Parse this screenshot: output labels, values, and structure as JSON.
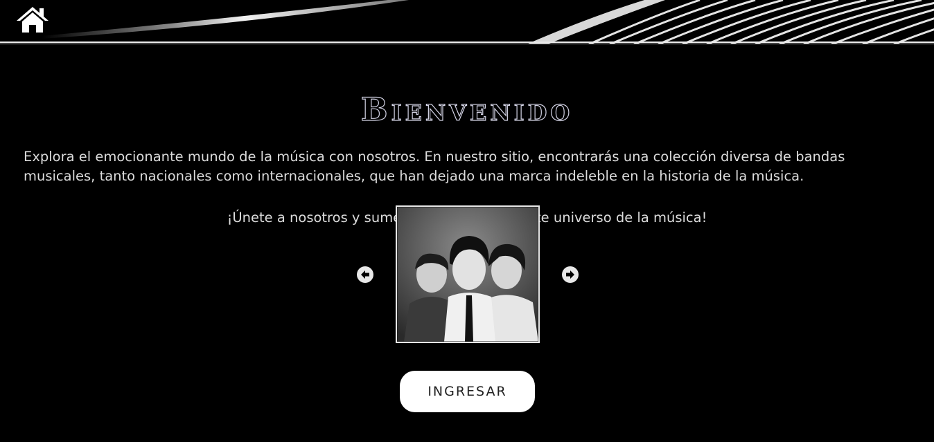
{
  "header": {
    "home_icon": "home-icon"
  },
  "main": {
    "title": "Bienvenido",
    "intro": "Explora el emocionante mundo de la música con nosotros. En nuestro sitio, encontrarás una colección diversa de bandas musicales, tanto nacionales como internacionales, que han dejado una marca indeleble en la historia de la música.",
    "cta": "¡Únete a nosotros y sumérgete en el fascinante universo de la música!",
    "carousel": {
      "prev_icon": "arrow-left-circle-icon",
      "next_icon": "arrow-right-circle-icon",
      "slide_image": "black-and-white band photo of three young men"
    },
    "enter_button": "INGRESAR"
  },
  "colors": {
    "background": "#000000",
    "text": "#dcdcdc",
    "button_bg": "#ffffff",
    "button_text": "#222222"
  }
}
